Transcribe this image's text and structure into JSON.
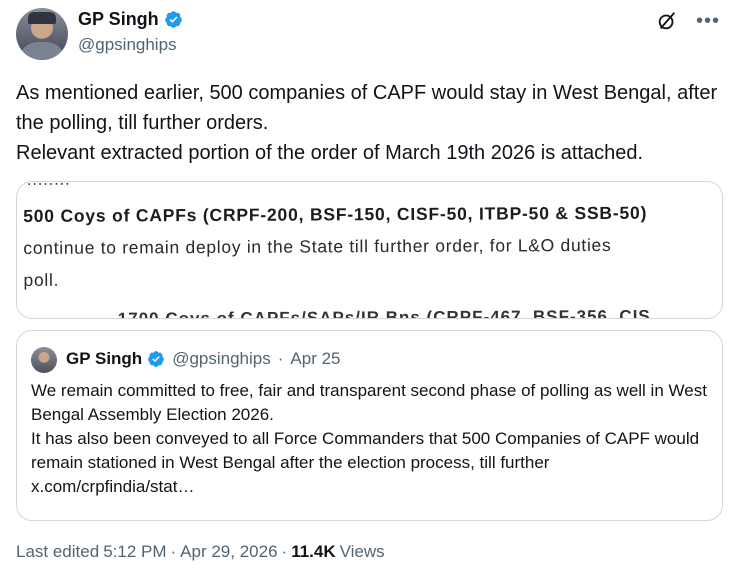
{
  "author": {
    "name": "GP Singh",
    "handle": "@gpsinghips"
  },
  "tweet": {
    "text": "As mentioned earlier, 500 companies of CAPF would stay in West Bengal, after the polling, till further orders.\nRelevant extracted portion of the order of March 19th 2026 is attached."
  },
  "media": {
    "top_fragment": "........",
    "line1": "500 Coys of CAPFs (CRPF-200, BSF-150, CISF-50, ITBP-50 & SSB-50)",
    "line2": "continue to remain deploy in the State till further order, for L&O duties",
    "line3": "poll.",
    "line4": "...... 1700 Coys of CAPFs/SAPs/IR Bns (CRPF-467, BSF-356, CIS"
  },
  "quote": {
    "name": "GP Singh",
    "handle": "@gpsinghips",
    "separator": "·",
    "date": "Apr 25",
    "text": "We remain committed to free, fair and transparent second phase of polling as well in West Bengal Assembly Election 2026.\nIt has also been conveyed to all Force Commanders that 500 Companies of CAPF would remain stationed in West Bengal after the election process, till further x.com/crpfindia/stat…"
  },
  "footer": {
    "edited_label": "Last edited",
    "time": "5:12 PM",
    "separator": "·",
    "date": "Apr 29, 2026",
    "views_count": "11.4K",
    "views_label": "Views"
  },
  "colors": {
    "verified": "#1d9bf0",
    "secondary_text": "#536471",
    "border": "#cfd9de"
  },
  "icons": {
    "verified": "verified-badge-icon",
    "grok": "grok-icon",
    "more": "more-icon"
  }
}
